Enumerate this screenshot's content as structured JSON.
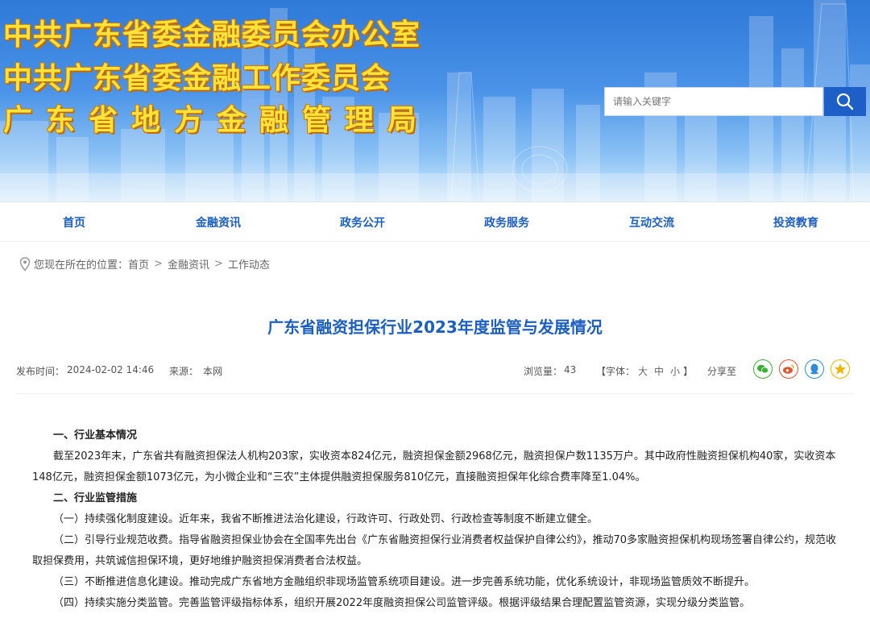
{
  "header": {
    "title_line1": "中共广东省委金融委员会办公室",
    "title_line2": "中共广东省委金融工作委员会",
    "title_line3": "广东省地方金融管理局",
    "search_placeholder": "请输入关键字",
    "accent_color": "#1d5fc7",
    "title_color": "#ffe23a"
  },
  "nav": {
    "items": [
      {
        "label": "首页"
      },
      {
        "label": "金融资讯"
      },
      {
        "label": "政务公开"
      },
      {
        "label": "政务服务"
      },
      {
        "label": "互动交流"
      },
      {
        "label": "投资教育"
      }
    ]
  },
  "breadcrumb": {
    "prefix": "您现在所在的位置：",
    "items": [
      "首页",
      "金融资讯",
      "工作动态"
    ],
    "separator": ">"
  },
  "article": {
    "title": "广东省融资担保行业2023年度监管与发展情况",
    "publish_label": "发布时间：",
    "publish_time": "2024-02-02 14:46",
    "source_label": "来源：",
    "source": "本网",
    "views_label": "浏览量：",
    "views": "43",
    "font_label_open": "【字体：",
    "font_large": "大",
    "font_medium": "中",
    "font_small": "小",
    "font_label_close": "】",
    "share_label": "分享至",
    "share_icons": [
      "wechat-icon",
      "weibo-icon",
      "qq-icon",
      "qzone-icon"
    ],
    "paragraphs": [
      {
        "text": "一、行业基本情况",
        "heading": true
      },
      {
        "text": "截至2023年末，广东省共有融资担保法人机构203家，实收资本824亿元，融资担保金额2968亿元，融资担保户数1135万户。其中政府性融资担保机构40家，实收资本148亿元，融资担保金额1073亿元，为小微企业和“三农”主体提供融资担保服务810亿元，直接融资担保年化综合费率降至1.04%。",
        "heading": false
      },
      {
        "text": "二、行业监管措施",
        "heading": true
      },
      {
        "text": "（一）持续强化制度建设。近年来，我省不断推进法治化建设，行政许可、行政处罚、行政检查等制度不断建立健全。",
        "heading": false
      },
      {
        "text": "（二）引导行业规范收费。指导省融资担保业协会在全国率先出台《广东省融资担保行业消费者权益保护自律公约》，推动70多家融资担保机构现场签署自律公约，规范收取担保费用，共筑诚信担保环境，更好地维护融资担保消费者合法权益。",
        "heading": false
      },
      {
        "text": "（三）不断推进信息化建设。推动完成广东省地方金融组织非现场监管系统项目建设。进一步完善系统功能，优化系统设计，非现场监管质效不断提升。",
        "heading": false
      },
      {
        "text": "（四）持续实施分类监管。完善监管评级指标体系，组织开展2022年度融资担保公司监管评级。根据评级结果合理配置监管资源，实现分级分类监管。",
        "heading": false
      }
    ]
  }
}
